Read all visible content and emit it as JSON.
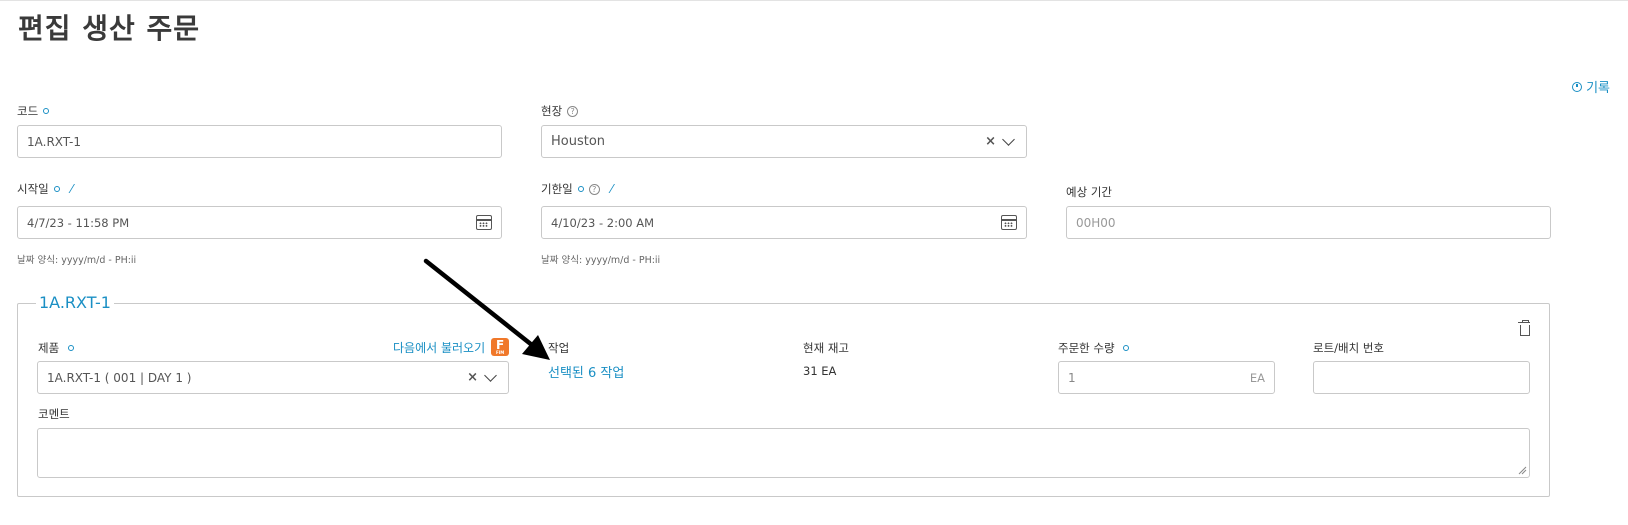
{
  "page": {
    "title": "편집 생산 주문",
    "history_label": "기록"
  },
  "form": {
    "code": {
      "label": "코드",
      "value": "1A.RXT-1"
    },
    "site": {
      "label": "현장",
      "value": "Houston"
    },
    "start_date": {
      "label": "시작일",
      "value": "4/7/23 - 11:58 PM",
      "hint": "날짜 양식: yyyy/m/d - PH:ii"
    },
    "due_date": {
      "label": "기한일",
      "value": "4/10/23 - 2:00 AM",
      "hint": "날짜 양식: yyyy/m/d - PH:ii"
    },
    "expected_duration": {
      "label": "예상 기간",
      "placeholder": "00H00"
    }
  },
  "item": {
    "legend": "1A.RXT-1",
    "product": {
      "label": "제품",
      "value": "1A.RXT-1 ( 001 | DAY 1 )",
      "import_link": "다음에서 불러오기",
      "import_icon": "F"
    },
    "operations": {
      "label": "작업",
      "link": "선택된 6 작업"
    },
    "current_stock": {
      "label": "현재 재고",
      "value": "31 EA"
    },
    "ordered_qty": {
      "label": "주문한 수량",
      "value": "1",
      "unit": "EA"
    },
    "lot_batch": {
      "label": "로트/배치 번호",
      "value": ""
    },
    "comment": {
      "label": "코멘트",
      "value": ""
    }
  },
  "colors": {
    "accent": "#1a8fc4",
    "brand_icon": "#f0782a"
  }
}
